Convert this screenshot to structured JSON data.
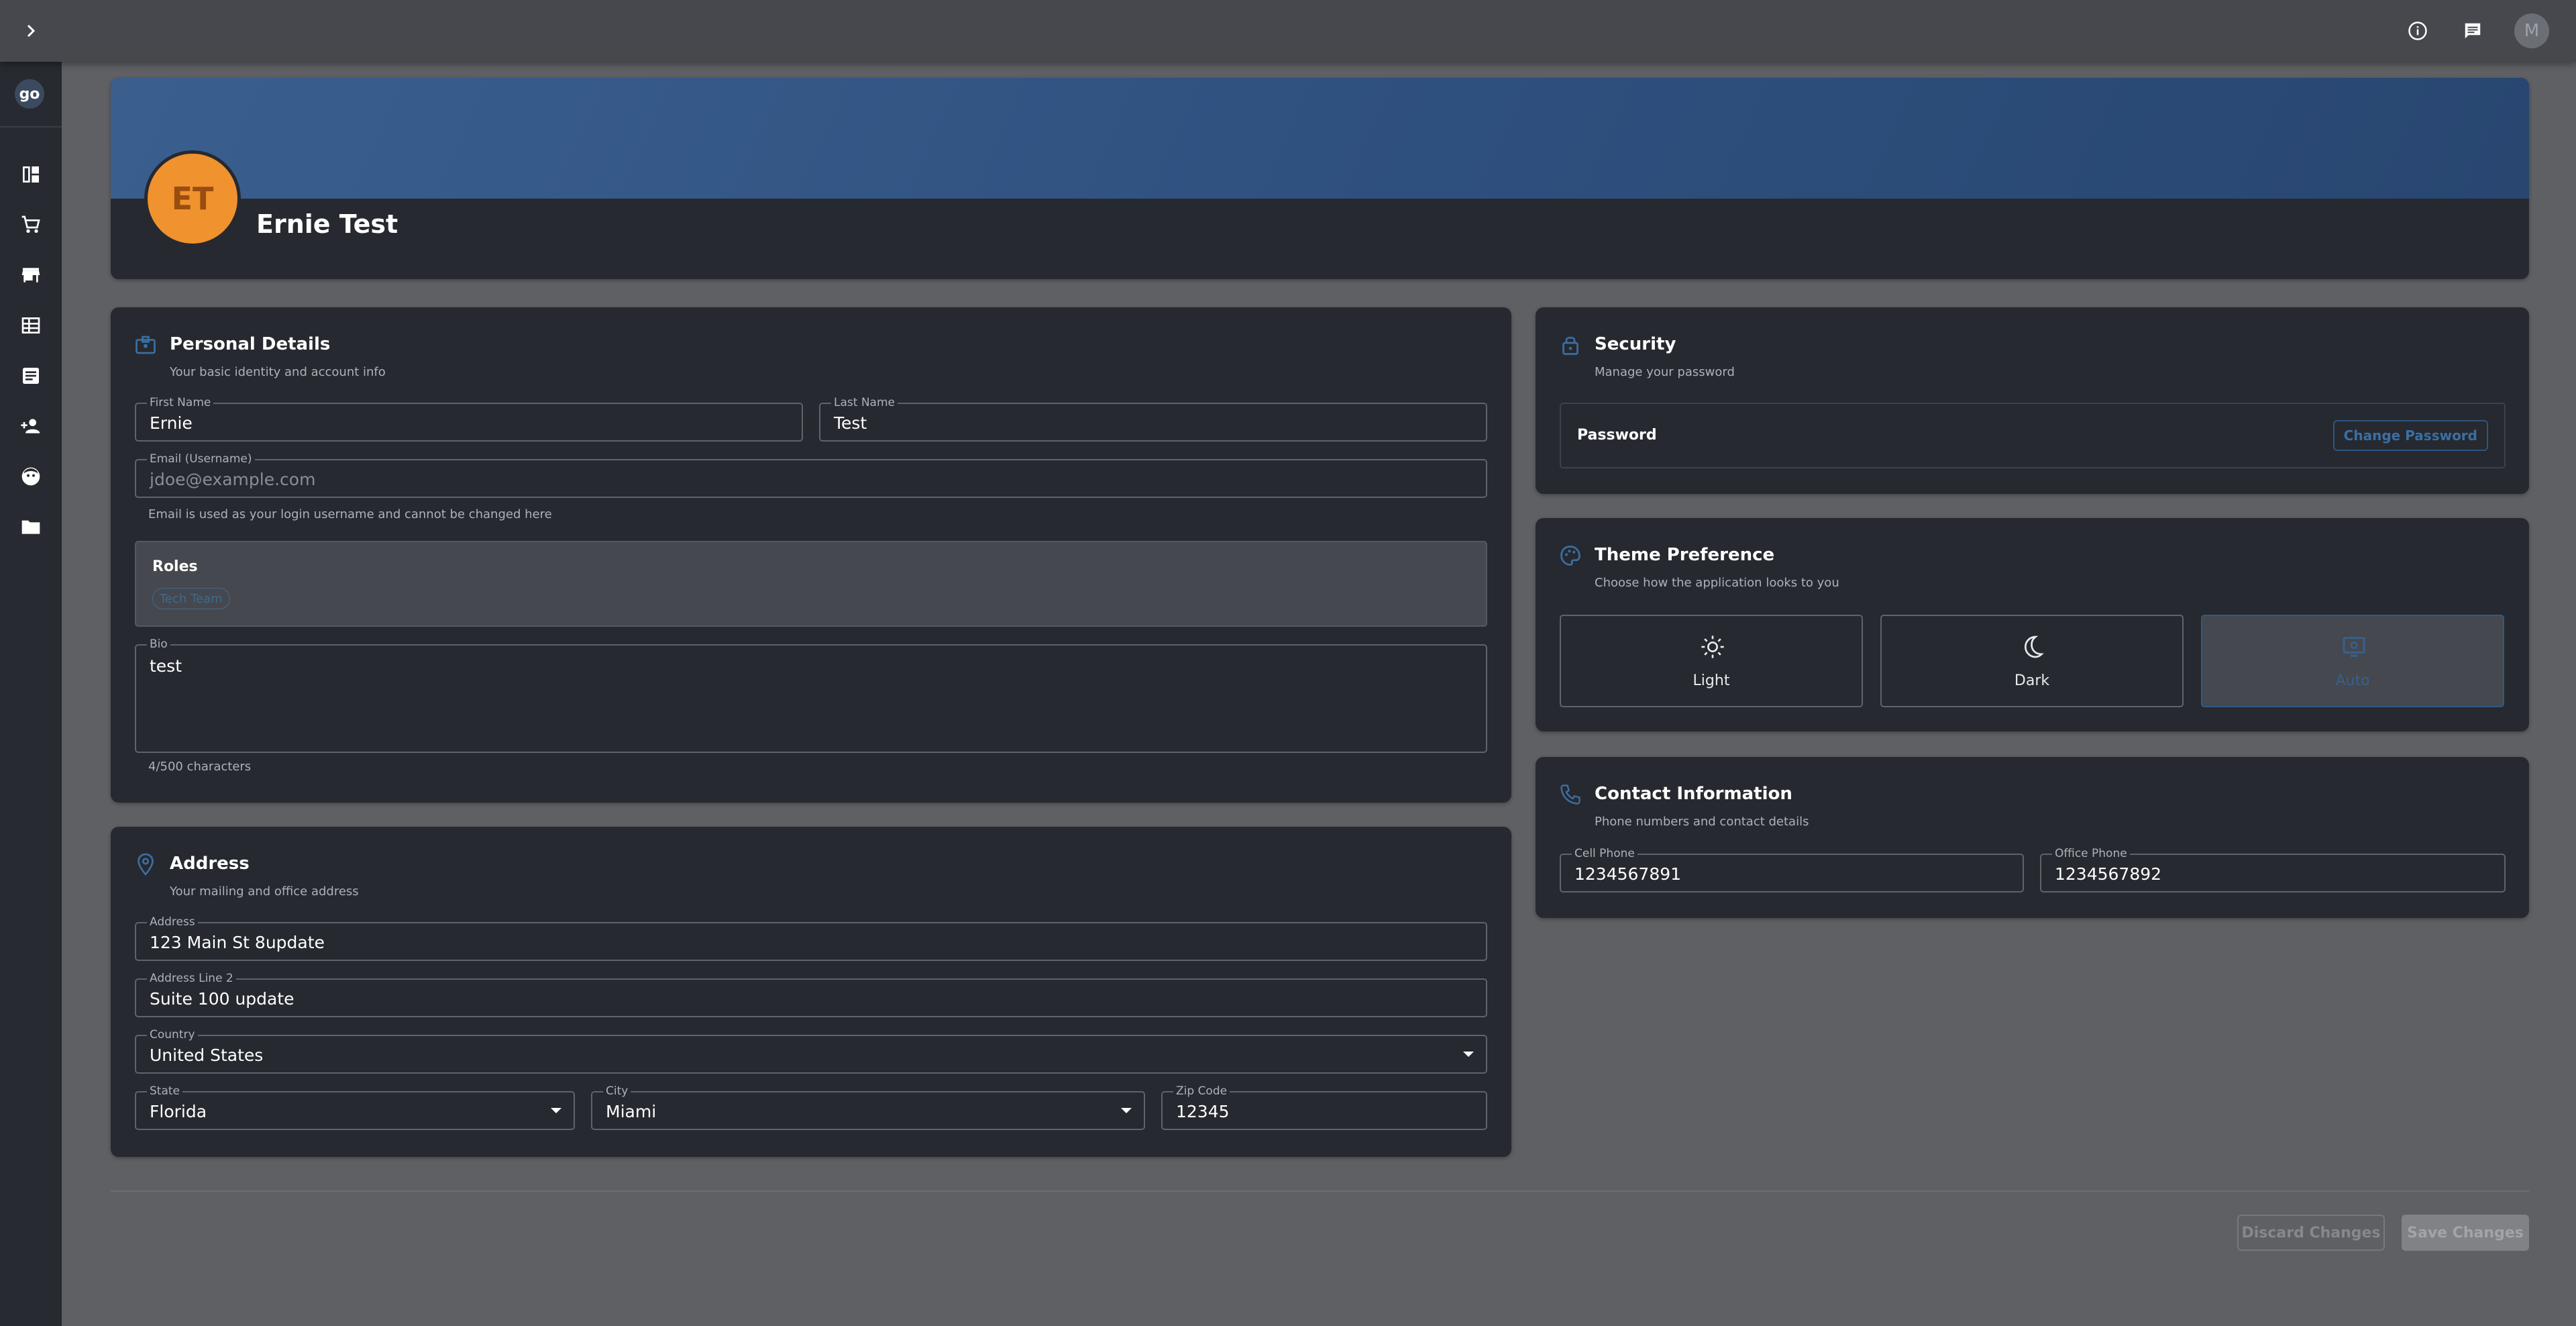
{
  "topbar": {
    "expand_icon": "chevron-right-icon",
    "info_icon": "info-icon",
    "chat_icon": "chat-icon",
    "user_initial": "M"
  },
  "sidebar": {
    "logo": "go",
    "items": [
      {
        "icon": "dashboard-icon"
      },
      {
        "icon": "cart-icon"
      },
      {
        "icon": "store-icon"
      },
      {
        "icon": "table-icon"
      },
      {
        "icon": "document-icon"
      },
      {
        "icon": "add-user-icon"
      },
      {
        "icon": "face-icon"
      },
      {
        "icon": "folder-icon"
      }
    ]
  },
  "profile": {
    "initials": "ET",
    "name": "Ernie Test"
  },
  "personal": {
    "title": "Personal Details",
    "subtitle": "Your basic identity and account info",
    "first_name_label": "First Name",
    "first_name": "Ernie",
    "last_name_label": "Last Name",
    "last_name": "Test",
    "email_label": "Email (Username)",
    "email": "jdoe@example.com",
    "email_helper": "Email is used as your login username and cannot be changed here",
    "roles_title": "Roles",
    "role_chip": "Tech Team",
    "bio_label": "Bio",
    "bio": "test",
    "bio_count": "4/500 characters"
  },
  "address": {
    "title": "Address",
    "subtitle": "Your mailing and office address",
    "address_label": "Address",
    "address": "123 Main St 8update",
    "address2_label": "Address Line 2",
    "address2": "Suite 100 update",
    "country_label": "Country",
    "country": "United States",
    "state_label": "State",
    "state": "Florida",
    "city_label": "City",
    "city": "Miami",
    "zip_label": "Zip Code",
    "zip": "12345"
  },
  "security": {
    "title": "Security",
    "subtitle": "Manage your password",
    "password_label": "Password",
    "change_button": "Change Password"
  },
  "theme": {
    "title": "Theme Preference",
    "subtitle": "Choose how the application looks to you",
    "options": [
      {
        "label": "Light",
        "icon": "sun-icon"
      },
      {
        "label": "Dark",
        "icon": "moon-icon"
      },
      {
        "label": "Auto",
        "icon": "monitor-icon"
      }
    ],
    "selected": "Auto"
  },
  "contact": {
    "title": "Contact Information",
    "subtitle": "Phone numbers and contact details",
    "cell_label": "Cell Phone",
    "cell": "1234567891",
    "office_label": "Office Phone",
    "office": "1234567892"
  },
  "footer": {
    "discard": "Discard Changes",
    "save": "Save Changes"
  },
  "colors": {
    "accent": "#2f5a86",
    "avatar": "#f0922e",
    "card": "#26292f"
  }
}
